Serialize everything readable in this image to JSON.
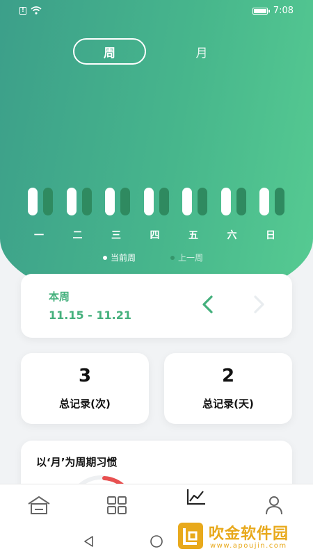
{
  "status_bar": {
    "time": "7:08",
    "sim_icon": "sim-alert-icon",
    "wifi_icon": "wifi-icon",
    "battery_icon": "battery-icon"
  },
  "period_tabs": {
    "week_label": "周",
    "month_label": "月",
    "selected": "周"
  },
  "chart_data": {
    "type": "bar",
    "categories": [
      "一",
      "二",
      "三",
      "四",
      "五",
      "六",
      "日"
    ],
    "series": [
      {
        "name": "当前周",
        "values": [
          1,
          1,
          1,
          1,
          1,
          1,
          1
        ]
      },
      {
        "name": "上一周",
        "values": [
          1,
          1,
          1,
          1,
          1,
          1,
          1
        ]
      }
    ],
    "legend_placement": "bottom"
  },
  "colors": {
    "accent": "#44b07c",
    "gradient_start": "#3c9f8a",
    "gradient_end": "#56cb92",
    "current_bar": "#ffffff",
    "previous_bar": "#2f8a60"
  },
  "week_card": {
    "label": "本周",
    "range": "11.15 - 11.21",
    "prev_icon": "chevron-left-icon",
    "next_icon": "chevron-right-icon"
  },
  "stats": {
    "total_records_count": "3",
    "total_records_count_label": "总记录(次)",
    "total_records_days": "2",
    "total_records_days_label": "总记录(天)"
  },
  "habit_card": {
    "title": "以‘月’为周期习惯"
  },
  "tab_bar": {
    "items": [
      {
        "icon": "home-icon"
      },
      {
        "icon": "grid-icon"
      },
      {
        "icon": "chart-icon"
      },
      {
        "icon": "user-icon"
      }
    ]
  },
  "nav_bar": {
    "back_icon": "back-triangle-icon",
    "home_icon": "home-circle-icon"
  },
  "watermark": {
    "text": "吹金软件园",
    "url": "www.apoujin.com"
  }
}
